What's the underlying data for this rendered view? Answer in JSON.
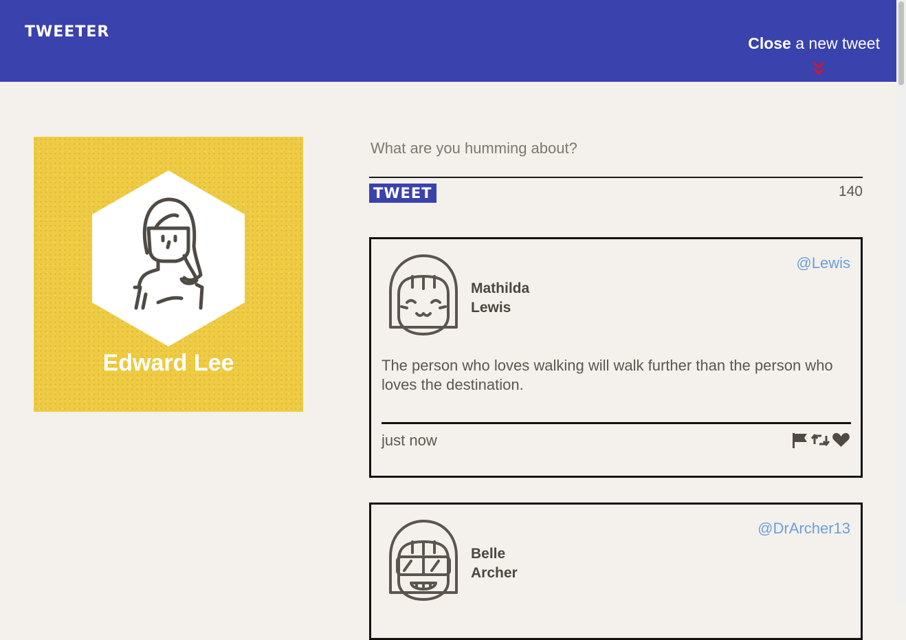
{
  "nav": {
    "brand": "TWEETER",
    "compose_toggle": {
      "strong": "Close",
      "rest": " a new tweet"
    },
    "chevron_icon": "double-chevron-down-icon",
    "chevron_color": "#d0162c"
  },
  "colors": {
    "nav_bg": "#3a42ad",
    "page_bg": "#f4f1ec",
    "profile_bg": "#eecb42",
    "handle": "#6b9ee0"
  },
  "profile": {
    "name": "Edward Lee"
  },
  "compose": {
    "placeholder": "What are you humming about?",
    "button_label": "TWEET",
    "counter": "140"
  },
  "tweets": [
    {
      "first_name": "Mathilda",
      "last_name": "Lewis",
      "handle": "@Lewis",
      "body": "The person who loves walking will walk further than the person who loves the destination.",
      "timestamp": "just now",
      "avatar_icon": "smiling-girl-avatar-icon"
    },
    {
      "first_name": "Belle",
      "last_name": "Archer",
      "handle": "@DrArcher13",
      "avatar_icon": "goggles-girl-avatar-icon"
    }
  ]
}
